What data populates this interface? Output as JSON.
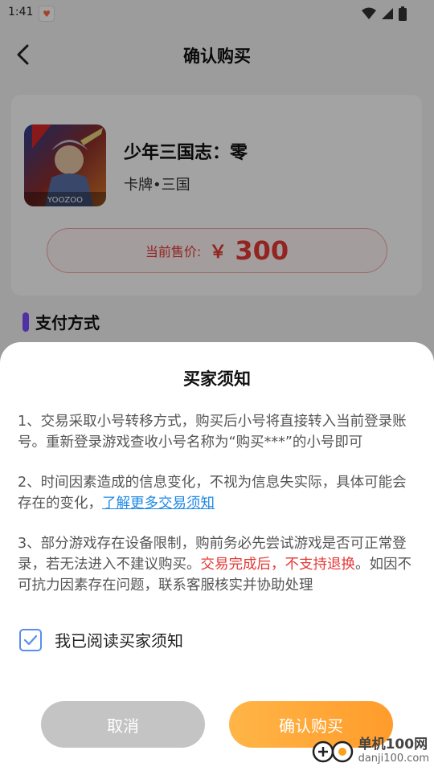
{
  "status": {
    "time": "1:41"
  },
  "header": {
    "title": "确认购买"
  },
  "product": {
    "title": "少年三国志：零",
    "tags": "卡牌•三国",
    "icon_caption": "YOOZOO",
    "price_label": "当前售价:",
    "currency": "￥",
    "price": "300"
  },
  "payment": {
    "section_title": "支付方式"
  },
  "notice": {
    "title": "买家须知",
    "item1": "1、交易采取小号转移方式，购买后小号将直接转入当前登录账号。重新登录游戏查收小号名称为“购买***”的小号即可",
    "item2_text": "2、时间因素造成的信息变化，不视为信息失实际，具体可能会存在的变化，",
    "item2_link": "了解更多交易须知",
    "item3_pre": "3、部分游戏存在设备限制，购前务必先尝试游戏是否可正常登录，若无法进入不建议购买。",
    "item3_warn": "交易完成后，不支持退换",
    "item3_post": "。如因不可抗力因素存在问题，联系客服核实并协助处理",
    "agree_label": "我已阅读买家须知",
    "agree_checked": true,
    "cancel_label": "取消",
    "confirm_label": "确认购买"
  },
  "watermark": {
    "line1": "单机100网",
    "line2": "danji100.com"
  },
  "colors": {
    "accent_red": "#e53935",
    "confirm_orange": "#ffa53b",
    "link_blue": "#1e88e5",
    "checkbox_blue": "#5b8def",
    "section_bar": "#7c4dff"
  }
}
